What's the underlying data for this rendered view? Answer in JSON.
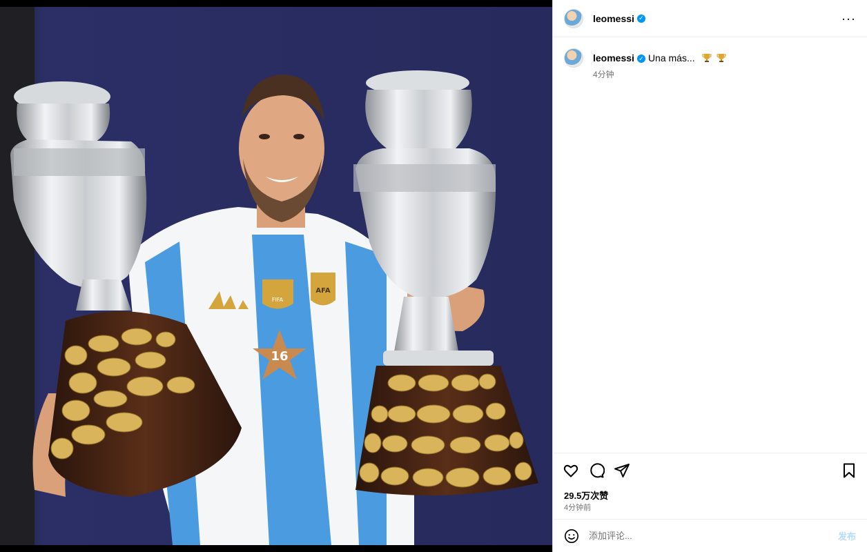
{
  "header": {
    "username": "leomessi",
    "verified_icon": "verified-badge-icon",
    "more_icon": "more-options-icon",
    "more_glyph": "···"
  },
  "caption": {
    "username": "leomessi",
    "text": "Una más...",
    "emoji_1": "trophy-icon",
    "emoji_2": "trophy-icon",
    "time": "4分钟"
  },
  "photo": {
    "jersey_number": "16",
    "badge_text": "FIFA",
    "crest_text": "AFA"
  },
  "actions": {
    "like_icon": "heart-icon",
    "comment_icon": "comment-icon",
    "share_icon": "send-icon",
    "save_icon": "bookmark-icon"
  },
  "likes": "29.5万次赞",
  "post_time": "4分钟前",
  "comment": {
    "emoji_icon": "emoji-icon",
    "placeholder": "添加评论...",
    "value": "",
    "post_label": "发布"
  },
  "colors": {
    "verified": "#0095f6",
    "post_button_disabled": "#b3dbff",
    "secondary_text": "#737373"
  }
}
